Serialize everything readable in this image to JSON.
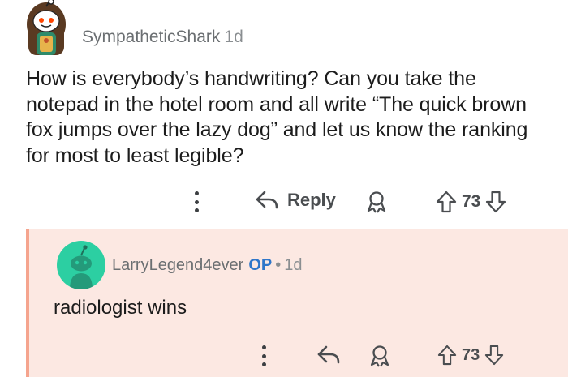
{
  "comment": {
    "username": "SympatheticShark",
    "age": "1d",
    "body": "How is everybody’s handwriting? Can you take the notepad in the hotel room and all write “The quick brown fox jumps over the lazy dog” and let us know the ranking for most to least legible?",
    "reply_label": "Reply",
    "score": "73"
  },
  "reply": {
    "username": "LarryLegend4ever",
    "op_badge": "OP",
    "separator": "•",
    "age": "1d",
    "body": "radiologist wins",
    "score": "73"
  },
  "colors": {
    "accent_op": "#2f76c9",
    "reply_background": "#fce8e2",
    "reply_thread_line": "#f5a48e",
    "avatar_reply": "#2ccfa2"
  }
}
